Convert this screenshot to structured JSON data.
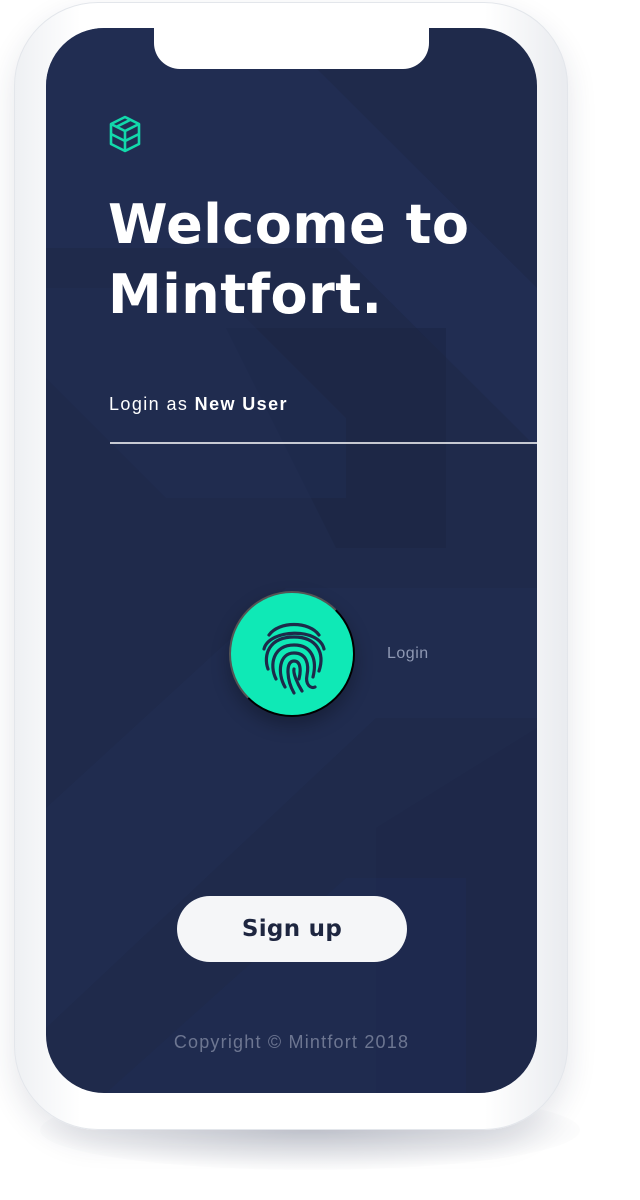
{
  "app": {
    "logo_icon": "mintfort-cube-icon",
    "accent_color": "#0fe9b6",
    "background_color": "#1f2a4b"
  },
  "welcome": {
    "title": "Welcome to Mintfort."
  },
  "login_mode": {
    "prefix": "Login as",
    "user_type": "New User"
  },
  "fingerprint": {
    "icon": "fingerprint-icon",
    "label": "Login"
  },
  "signup": {
    "label": "Sign up"
  },
  "footer": {
    "copyright": "Copyright © Mintfort 2018"
  }
}
